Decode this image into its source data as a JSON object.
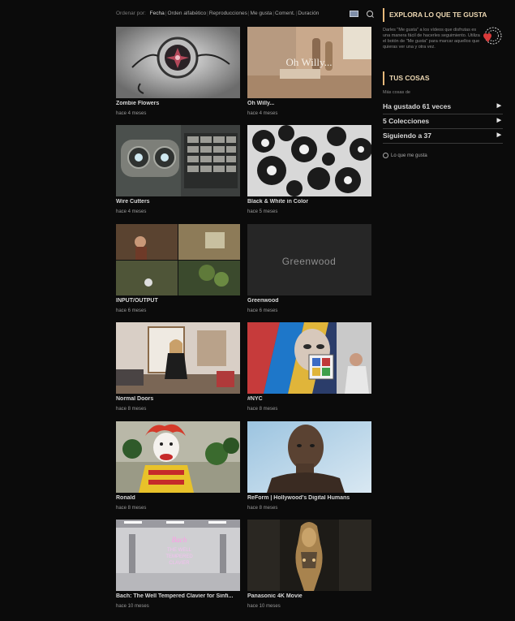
{
  "sort": {
    "label": "Ordenar por:",
    "options": [
      "Fecha",
      "Orden alfabético",
      "Reproducciones",
      "Me gusta",
      "Coment.",
      "Duración"
    ]
  },
  "icons": {
    "view": "grid-view-icon",
    "search": "search-icon",
    "heart": "heart-logo-icon",
    "rss": "rss-icon",
    "arrow": "play-arrow-icon"
  },
  "videos": [
    {
      "title": "Zombie Flowers",
      "meta": "hace 4 meses"
    },
    {
      "title": "Oh Willy...",
      "meta": "hace 4 meses"
    },
    {
      "title": "Wire Cutters",
      "meta": "hace 4 meses"
    },
    {
      "title": "Black & White in Color",
      "meta": "hace 5 meses"
    },
    {
      "title": "INPUT/OUTPUT",
      "meta": "hace 6 meses"
    },
    {
      "title": "Greenwood",
      "meta": "hace 6 meses"
    },
    {
      "title": "Normal Doors",
      "meta": "hace 8 meses"
    },
    {
      "title": "#NYC",
      "meta": "hace 8 meses"
    },
    {
      "title": "Ronald",
      "meta": "hace 8 meses"
    },
    {
      "title": "ReForm | Hollywood's Digital Humans",
      "meta": "hace 8 meses"
    },
    {
      "title": "Bach: The Well Tempered Clavier for Sinfi...",
      "meta": "hace 10 meses"
    },
    {
      "title": "Panasonic 4K Movie",
      "meta": "hace 10 meses"
    }
  ],
  "thumb_text": {
    "oh_willy": "Oh Willy...",
    "greenwood": "Greenwood",
    "bach_line1": "Bach",
    "bach_line2": "THE WELL",
    "bach_line3": "TEMPERED",
    "bach_line4": "CLAVIER"
  },
  "sidebar": {
    "explore_title": "EXPLORA LO QUE TE GUSTA",
    "explore_text": "Darles \"Me gusta\" a los vídeos que disfrutas es una manera fácil de hacerles seguimiento. Utiliza el botón de \"Me gusta\" para marcar aquellos que quieras ver una y otra vez.",
    "your_title": "TUS COSAS",
    "small_label": "Más cosas de",
    "rows": [
      "Ha gustado 61 veces",
      "5 Colecciones",
      "Siguiendo a 37"
    ],
    "likes_link": "Lo que me gusta"
  },
  "colors": {
    "accent": "#e7b87a",
    "background": "#0b0b0b"
  }
}
